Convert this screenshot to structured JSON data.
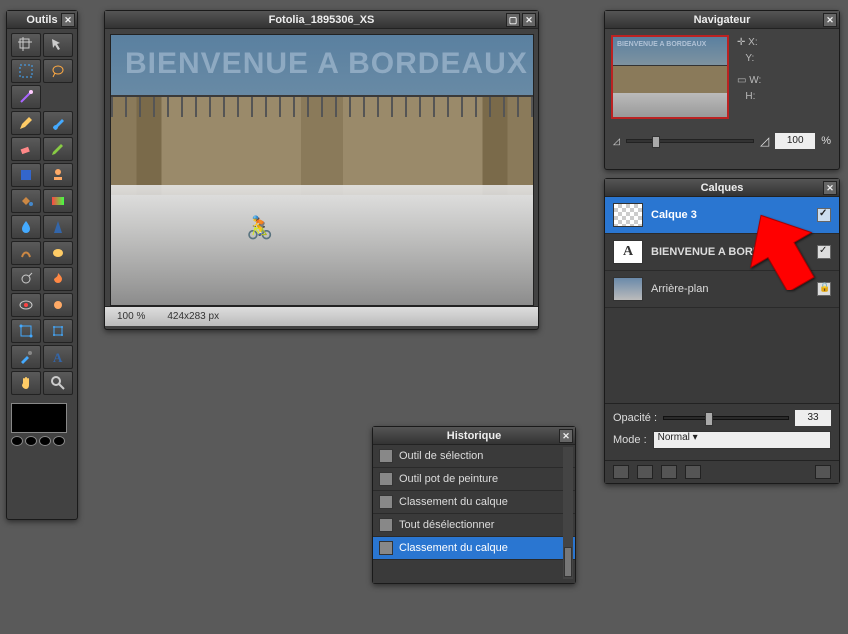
{
  "tools_panel": {
    "title": "Outils"
  },
  "document": {
    "title": "Fotolia_1895306_XS",
    "overlay_text": "BIENVENUE A BORDEAUX",
    "zoom_label": "100 %",
    "dims_label": "424x283 px"
  },
  "history": {
    "title": "Historique",
    "items": [
      {
        "label": "Outil de sélection"
      },
      {
        "label": "Outil pot de peinture"
      },
      {
        "label": "Classement du calque"
      },
      {
        "label": "Tout désélectionner"
      },
      {
        "label": "Classement du calque"
      }
    ]
  },
  "navigator": {
    "title": "Navigateur",
    "x_label": "X:",
    "y_label": "Y:",
    "w_label": "W:",
    "h_label": "H:",
    "zoom_value": "100",
    "zoom_suffix": "%",
    "thumb_text": "BIENVENUE A BORDEAUX"
  },
  "layers": {
    "title": "Calques",
    "items": [
      {
        "name": "Calque 3",
        "visible": true,
        "type": "checker"
      },
      {
        "name": "BIENVENUE A BORDEAUX",
        "visible": true,
        "type": "text"
      },
      {
        "name": "Arrière-plan",
        "locked": true,
        "type": "img"
      }
    ],
    "opacity_label": "Opacité :",
    "opacity_value": "33",
    "mode_label": "Mode :",
    "mode_value": "Normal"
  },
  "tool_names": [
    "crop-icon",
    "move-icon",
    "marquee-icon",
    "lasso-icon",
    "wand-icon",
    "pencil-icon",
    "brush-icon",
    "eraser-icon",
    "edit-icon",
    "fill-icon",
    "stamp-icon",
    "bucket-icon",
    "gradient-icon",
    "blur-icon",
    "sharpen-icon",
    "smudge-icon",
    "sponge-icon",
    "dodge-icon",
    "burn-icon",
    "redeye-icon",
    "blob-icon",
    "warp-icon",
    "mesh-icon",
    "eyedropper-icon",
    "type-icon",
    "hand-icon",
    "zoom-icon"
  ]
}
